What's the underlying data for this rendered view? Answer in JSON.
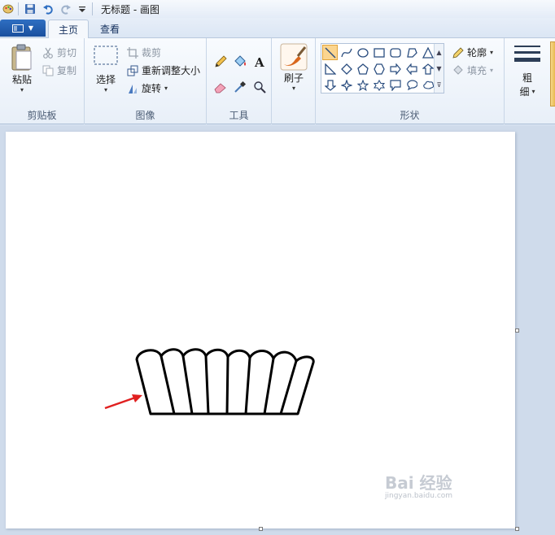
{
  "titlebar": {
    "title": "无标题 - 画图",
    "qa_icons": [
      "paint-app-icon",
      "save-icon",
      "undo-icon",
      "redo-icon",
      "customize-arrow-icon"
    ]
  },
  "tabs": {
    "home": "主页",
    "view": "查看"
  },
  "clipboard": {
    "paste": "粘贴",
    "cut": "剪切",
    "copy": "复制",
    "label": "剪贴板"
  },
  "image": {
    "select": "选择",
    "crop": "裁剪",
    "resize": "重新调整大小",
    "rotate": "旋转",
    "label": "图像"
  },
  "tools": {
    "label": "工具",
    "items": [
      "pencil-icon",
      "fill-icon",
      "text-icon",
      "eraser-icon",
      "color-picker-icon",
      "magnifier-icon"
    ]
  },
  "brushes": {
    "label": "刷子"
  },
  "shapes": {
    "outline": "轮廓",
    "fill": "填充",
    "label": "形状",
    "selected": "line"
  },
  "size": {
    "label_line1": "粗",
    "label_line2": "细"
  },
  "colors": {
    "accent": "#2f6fc2",
    "arrow": "#e02020"
  },
  "watermark": {
    "brand": "Bai 经验",
    "url": "jingyan.baidu.com"
  }
}
